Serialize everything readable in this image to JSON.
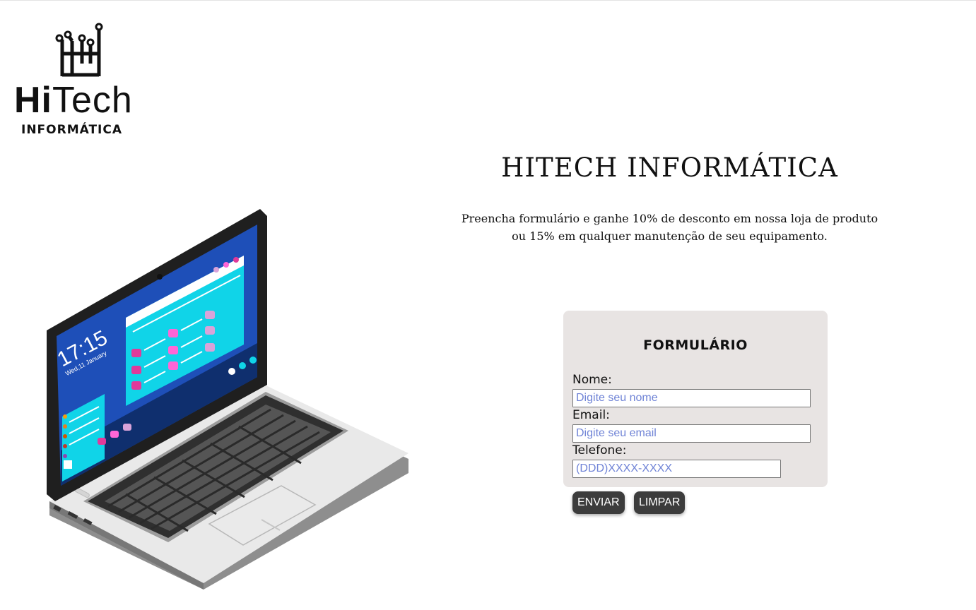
{
  "logo": {
    "word_bold": "Hi",
    "word_regular": "Tech",
    "subtitle": "INFORMÁTICA",
    "icon": "circuit-h-icon"
  },
  "header": {
    "title": "HITECH INFORMÁTICA",
    "subtitle_line1": "Preencha formulário e ganhe 10% de desconto em nossa loja de produto",
    "subtitle_line2": "ou 15% em qualquer manutenção de seu equipamento."
  },
  "illustration": {
    "icon": "laptop-illustration",
    "clock_time": "17:15",
    "clock_date": "Wed,11 January"
  },
  "form": {
    "title": "FORMULÁRIO",
    "name_label": "Nome:",
    "name_placeholder": "Digite seu nome",
    "email_label": "Email:",
    "email_placeholder": "Digite seu email",
    "phone_label": "Telefone:",
    "phone_placeholder": "(DDD)XXXX-XXXX",
    "submit_label": "ENVIAR",
    "reset_label": "LIMPAR"
  },
  "colors": {
    "card_bg": "#e8e4e3",
    "button_bg": "#3c3c3c",
    "placeholder": "#6f83d6",
    "screen_blue": "#1e4fb8",
    "screen_cyan": "#10d4e8"
  }
}
